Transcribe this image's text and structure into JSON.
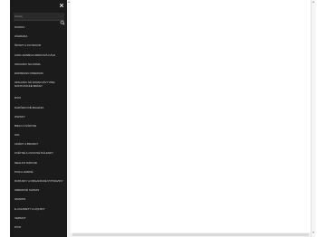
{
  "menu": {
    "close_icon": "close-icon",
    "search": {
      "placeholder": "Hľadaj",
      "icon": "search-icon"
    },
    "items": [
      {
        "label": "DOMOV"
      },
      {
        "label": "ZÁHRADA"
      },
      {
        "label": "ŠPORT A OUTDOOR"
      },
      {
        "label": "100% ARABICA ZRNKOVÁ KÁVA"
      },
      {
        "label": "ORGANIC NA DOMA"
      },
      {
        "label": "ESPRESSO PREMIUM"
      },
      {
        "label": "ORGANIC NÁ DOMA KÁVY PRE NONTOXICKÉ BRÁNY"
      },
      {
        "label": "RUM"
      },
      {
        "label": "DARČEKOVÉ BALENIA"
      },
      {
        "label": "WHISKY"
      },
      {
        "label": "BIELO A NÁPOJE"
      },
      {
        "label": "GIN"
      },
      {
        "label": "LIKÉRY A BRANDY"
      },
      {
        "label": "KVĚTNÉ A OVOCNÉ PÁLENKY"
      },
      {
        "label": "NEALKO NÁPOJE"
      },
      {
        "label": "PIVA A HORKÉ"
      },
      {
        "label": "DOPLNKY A ORGANICKÉ POTRAVINY"
      },
      {
        "label": "KREMOVÉ CHINAS"
      },
      {
        "label": "GRAPPA"
      },
      {
        "label": "E-CIGARETY A LIQUIDY"
      },
      {
        "label": "VERMUT"
      },
      {
        "label": "PIVO"
      }
    ]
  },
  "colors": {
    "sidebar_bg": "#1b1b1b",
    "sidebar_text": "#d6d6d6",
    "page_bg": "#ffffff"
  }
}
